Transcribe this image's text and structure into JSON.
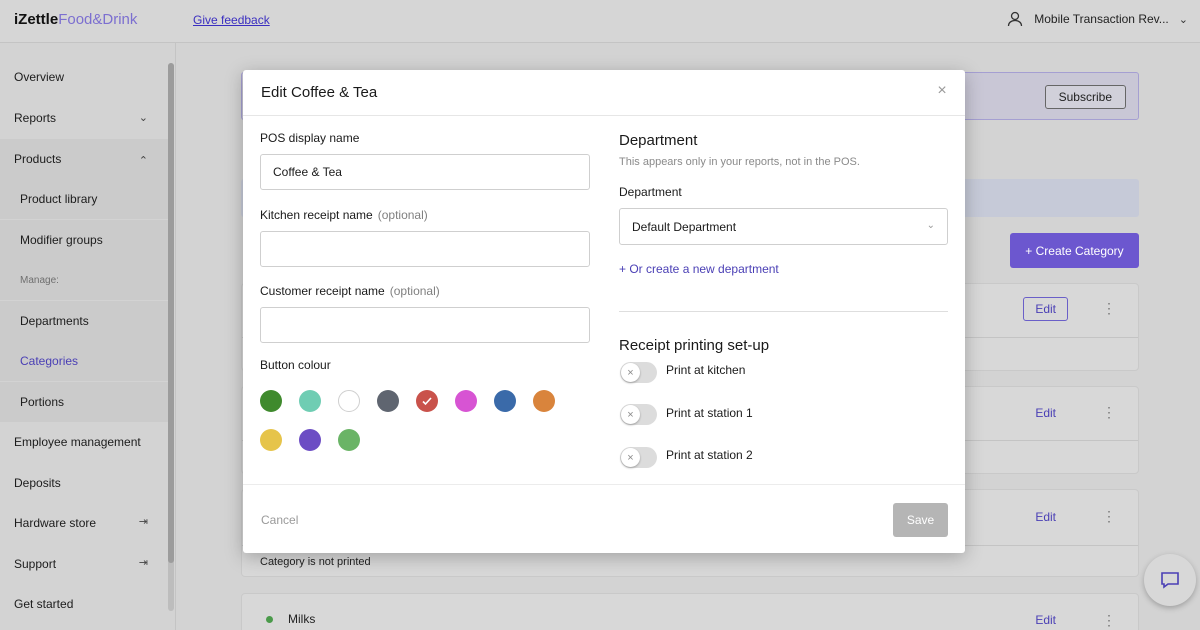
{
  "topbar": {
    "brand_primary": "iZettle",
    "brand_secondary": "Food&Drink",
    "feedback_link": "Give feedback",
    "account_name": "Mobile Transaction Rev...",
    "account_icon": "user-icon"
  },
  "sidebar": {
    "items": [
      {
        "label": "Overview"
      },
      {
        "label": "Reports"
      },
      {
        "label": "Products"
      },
      {
        "label": "Product library"
      },
      {
        "label": "Modifier groups"
      },
      {
        "label": "Manage:"
      },
      {
        "label": "Departments"
      },
      {
        "label": "Categories"
      },
      {
        "label": "Portions"
      },
      {
        "label": "Employee management"
      },
      {
        "label": "Deposits"
      },
      {
        "label": "Hardware store"
      },
      {
        "label": "Support"
      },
      {
        "label": "Get started"
      }
    ]
  },
  "background": {
    "subscribe_label": "Subscribe",
    "create_category_label": "+ Create Category",
    "edit_label": "Edit",
    "category_not_printed": "Category is not printed",
    "milks_label": "Milks"
  },
  "modal": {
    "title": "Edit Coffee & Tea",
    "pos_display_label": "POS display name",
    "pos_display_value": "Coffee & Tea",
    "kitchen_label": "Kitchen receipt name",
    "kitchen_optional": "(optional)",
    "kitchen_value": "",
    "customer_label": "Customer receipt name",
    "customer_optional": "(optional)",
    "customer_value": "",
    "button_colour_label": "Button colour",
    "colours": [
      "#3f8a2d",
      "#6fcdb3",
      "#ffffff",
      "#5f6570",
      "#c9524b",
      "#d754d3",
      "#3a6aa9",
      "#d9843c",
      "#e6c44a",
      "#6c4dc4",
      "#6ab466"
    ],
    "selected_colour": "#c9524b",
    "department_title": "Department",
    "department_sub": "This appears only in your reports, not in the POS.",
    "department_label": "Department",
    "department_value": "Default Department",
    "create_department": "+ Or create a new department",
    "printing_title": "Receipt printing set-up",
    "toggles": [
      {
        "label": "Print at kitchen",
        "on": false
      },
      {
        "label": "Print at station 1",
        "on": false
      },
      {
        "label": "Print at station 2",
        "on": false
      }
    ],
    "cancel_label": "Cancel",
    "save_label": "Save"
  }
}
